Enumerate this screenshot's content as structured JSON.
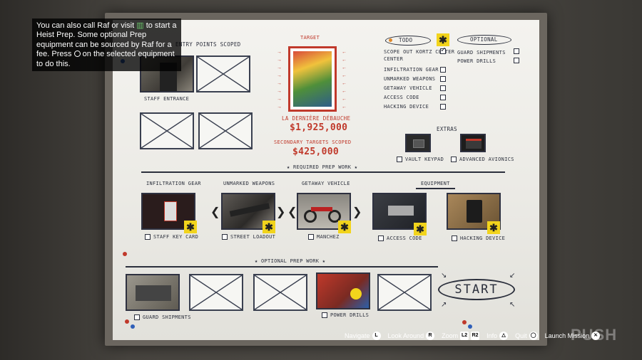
{
  "tooltip": {
    "part1": "You can also call Raf or visit",
    "part2": "to start a Heist Prep. Some optional Prep equipment can be sourced by Raf for a fee. Press",
    "part3": "on the selected equipment to do this."
  },
  "board": {
    "entry_points": {
      "heading": "Entry Points Scoped",
      "first_label": "Staff Entrance"
    },
    "target": {
      "heading": "Target",
      "name": "La Dernière Débauche",
      "value": "$1,925,000",
      "secondary_heading": "Secondary Targets Scoped",
      "secondary_value": "$425,000"
    },
    "todo": {
      "heading": "ToDo",
      "items": [
        {
          "label": "Scope out Kortz Center",
          "checked": true
        },
        {
          "label": "Infiltration Gear",
          "checked": false
        },
        {
          "label": "Unmarked Weapons",
          "checked": false
        },
        {
          "label": "Getaway Vehicle",
          "checked": false
        },
        {
          "label": "Access Code",
          "checked": false
        },
        {
          "label": "Hacking Device",
          "checked": false
        }
      ]
    },
    "optional": {
      "heading": "Optional",
      "items": [
        {
          "label": "Guard Shipments",
          "checked": false
        },
        {
          "label": "Power Drills",
          "checked": false
        }
      ]
    },
    "extras": {
      "heading": "Extras",
      "items": [
        {
          "label": "Vault Keypad"
        },
        {
          "label": "Advanced Avionics"
        }
      ]
    },
    "required_heading": "★ Required Prep Work ★",
    "required": [
      {
        "heading": "Infiltration Gear",
        "label": "Staff Key Card"
      },
      {
        "heading": "Unmarked Weapons",
        "label": "Street Loadout"
      },
      {
        "heading": "Getaway Vehicle",
        "label": "Manchez"
      },
      {
        "heading": "Equipment",
        "label": "Access Code"
      },
      {
        "heading": "",
        "label": "Hacking Device"
      }
    ],
    "optional_heading": "★ Optional Prep Work ★",
    "optional_prep": [
      {
        "label": "Guard Shipments"
      },
      {
        "label": "Power Drills"
      }
    ],
    "start_label": "START",
    "badge_glyph": "✱",
    "nav_left": "❮",
    "nav_right": "❯"
  },
  "controls": [
    {
      "label": "Navigate",
      "button": "L"
    },
    {
      "label": "Look Around",
      "button": "R"
    },
    {
      "label": "Zoom",
      "button": "L2",
      "button2": "R2"
    },
    {
      "label": "Info",
      "button": "△"
    },
    {
      "label": "Quit",
      "button": "◯"
    },
    {
      "label": "Launch Mission",
      "button": "✕"
    }
  ],
  "watermark": "PUSH",
  "colors": {
    "badge": "#f2d41c",
    "ink": "#2b2f3c",
    "red_ink": "#c0392b",
    "pin_red": "#c0392b",
    "pin_blue": "#2f5fb8"
  }
}
